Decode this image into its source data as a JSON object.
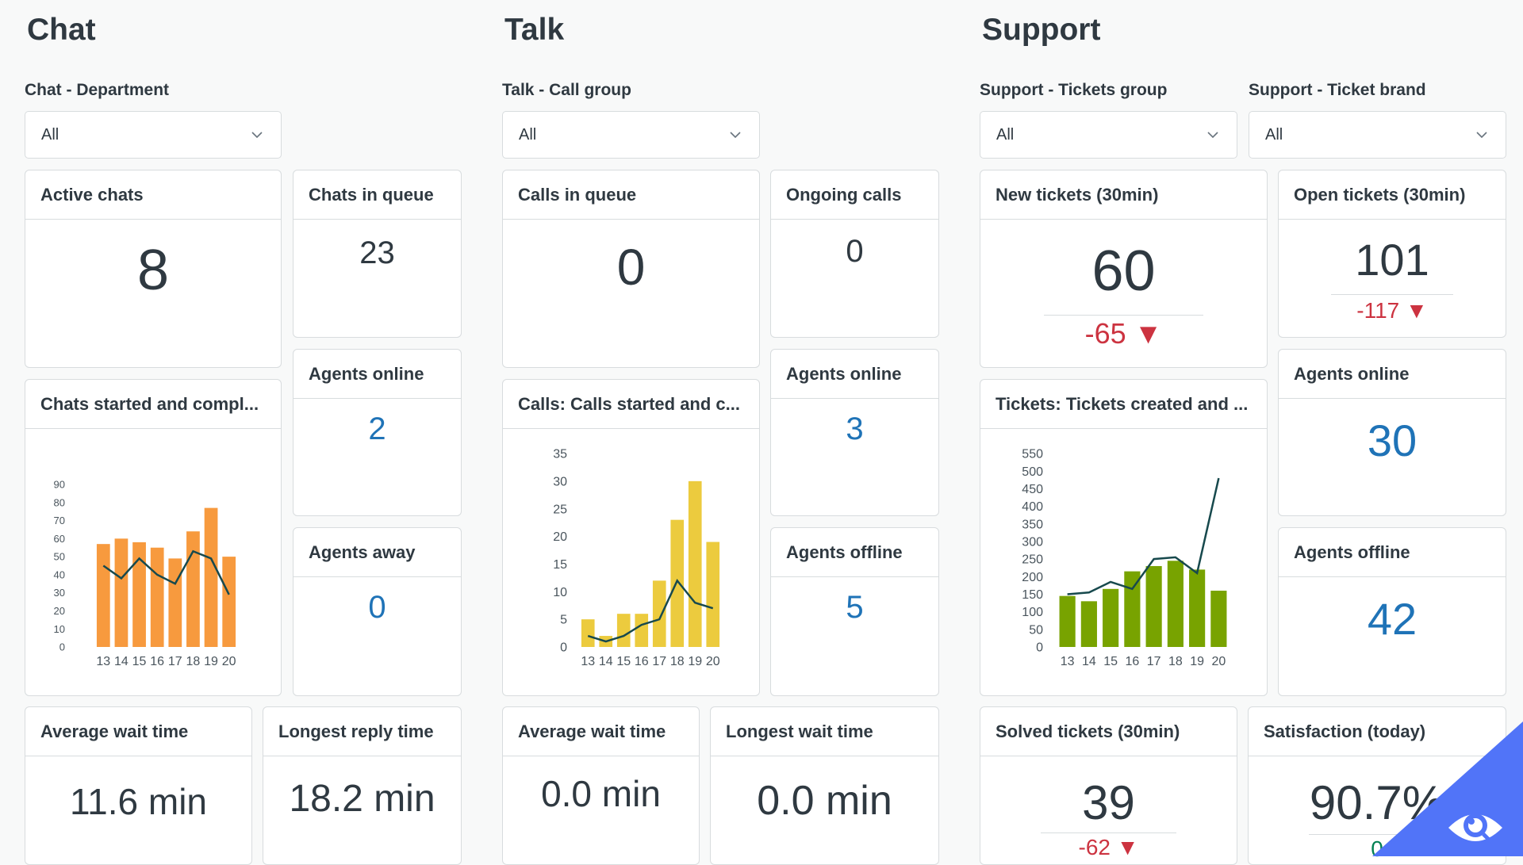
{
  "chat": {
    "title": "Chat",
    "filter_label": "Chat - Department",
    "filter_value": "All",
    "active_chats": {
      "label": "Active chats",
      "value": "8"
    },
    "chats_in_queue": {
      "label": "Chats in queue",
      "value": "23"
    },
    "agents_online": {
      "label": "Agents online",
      "value": "2"
    },
    "agents_away": {
      "label": "Agents away",
      "value": "0"
    },
    "chart_title": "Chats started and compl...",
    "avg_wait": {
      "label": "Average wait time",
      "value": "11.6 min"
    },
    "longest_reply": {
      "label": "Longest reply time",
      "value": "18.2 min"
    }
  },
  "talk": {
    "title": "Talk",
    "filter_label": "Talk - Call group",
    "filter_value": "All",
    "calls_in_queue": {
      "label": "Calls in queue",
      "value": "0"
    },
    "ongoing_calls": {
      "label": "Ongoing calls",
      "value": "0"
    },
    "agents_online": {
      "label": "Agents online",
      "value": "3"
    },
    "agents_offline": {
      "label": "Agents offline",
      "value": "5"
    },
    "chart_title": "Calls: Calls started and c...",
    "avg_wait": {
      "label": "Average wait time",
      "value": "0.0 min"
    },
    "longest_wait": {
      "label": "Longest wait time",
      "value": "0.0 min"
    }
  },
  "support": {
    "title": "Support",
    "filter1_label": "Support - Tickets group",
    "filter1_value": "All",
    "filter2_label": "Support - Ticket brand",
    "filter2_value": "All",
    "new_tickets": {
      "label": "New tickets (30min)",
      "value": "60",
      "delta": "-65 ▼"
    },
    "open_tickets": {
      "label": "Open tickets (30min)",
      "value": "101",
      "delta": "-117 ▼"
    },
    "agents_online": {
      "label": "Agents online",
      "value": "30"
    },
    "agents_offline": {
      "label": "Agents offline",
      "value": "42"
    },
    "chart_title": "Tickets: Tickets created and ...",
    "solved_tickets": {
      "label": "Solved tickets (30min)",
      "value": "39",
      "delta": "-62 ▼"
    },
    "satisfaction": {
      "label": "Satisfaction (today)",
      "value": "90.7%",
      "delta": "0"
    }
  },
  "colors": {
    "metric_blue": "#1f73b7",
    "delta_red": "#cc3340",
    "delta_green": "#038153",
    "badge": "#5174f8",
    "line": "#17494d"
  },
  "chart_data": [
    {
      "type": "bar",
      "categories": [
        "13",
        "14",
        "15",
        "16",
        "17",
        "18",
        "19",
        "20"
      ],
      "ylim": [
        0,
        90
      ],
      "yticks": [
        0,
        10,
        20,
        30,
        40,
        50,
        60,
        70,
        80,
        90
      ],
      "bar_color": "#f79a3e",
      "series": [
        {
          "type": "bar",
          "values": [
            57,
            60,
            58,
            55,
            49,
            64,
            77,
            50
          ]
        },
        {
          "type": "line",
          "values": [
            45,
            38,
            49,
            40,
            35,
            53,
            49,
            29
          ]
        }
      ]
    },
    {
      "type": "bar",
      "categories": [
        "13",
        "14",
        "15",
        "16",
        "17",
        "18",
        "19",
        "20"
      ],
      "ylim": [
        0,
        35
      ],
      "yticks": [
        0,
        5,
        10,
        15,
        20,
        25,
        30,
        35
      ],
      "bar_color": "#eccb3e",
      "series": [
        {
          "type": "bar",
          "values": [
            5,
            2,
            6,
            6,
            12,
            23,
            30,
            19
          ]
        },
        {
          "type": "line",
          "values": [
            2,
            1,
            2,
            4,
            5,
            12,
            8,
            7
          ]
        }
      ]
    },
    {
      "type": "bar",
      "categories": [
        "13",
        "14",
        "15",
        "16",
        "17",
        "18",
        "19",
        "20"
      ],
      "ylim": [
        0,
        550
      ],
      "yticks": [
        0,
        50,
        100,
        150,
        200,
        250,
        300,
        350,
        400,
        450,
        500,
        550
      ],
      "bar_color": "#78a300",
      "series": [
        {
          "type": "bar",
          "values": [
            145,
            130,
            165,
            215,
            230,
            245,
            220,
            160
          ]
        },
        {
          "type": "line",
          "values": [
            150,
            155,
            185,
            165,
            250,
            255,
            210,
            480
          ]
        }
      ]
    }
  ]
}
